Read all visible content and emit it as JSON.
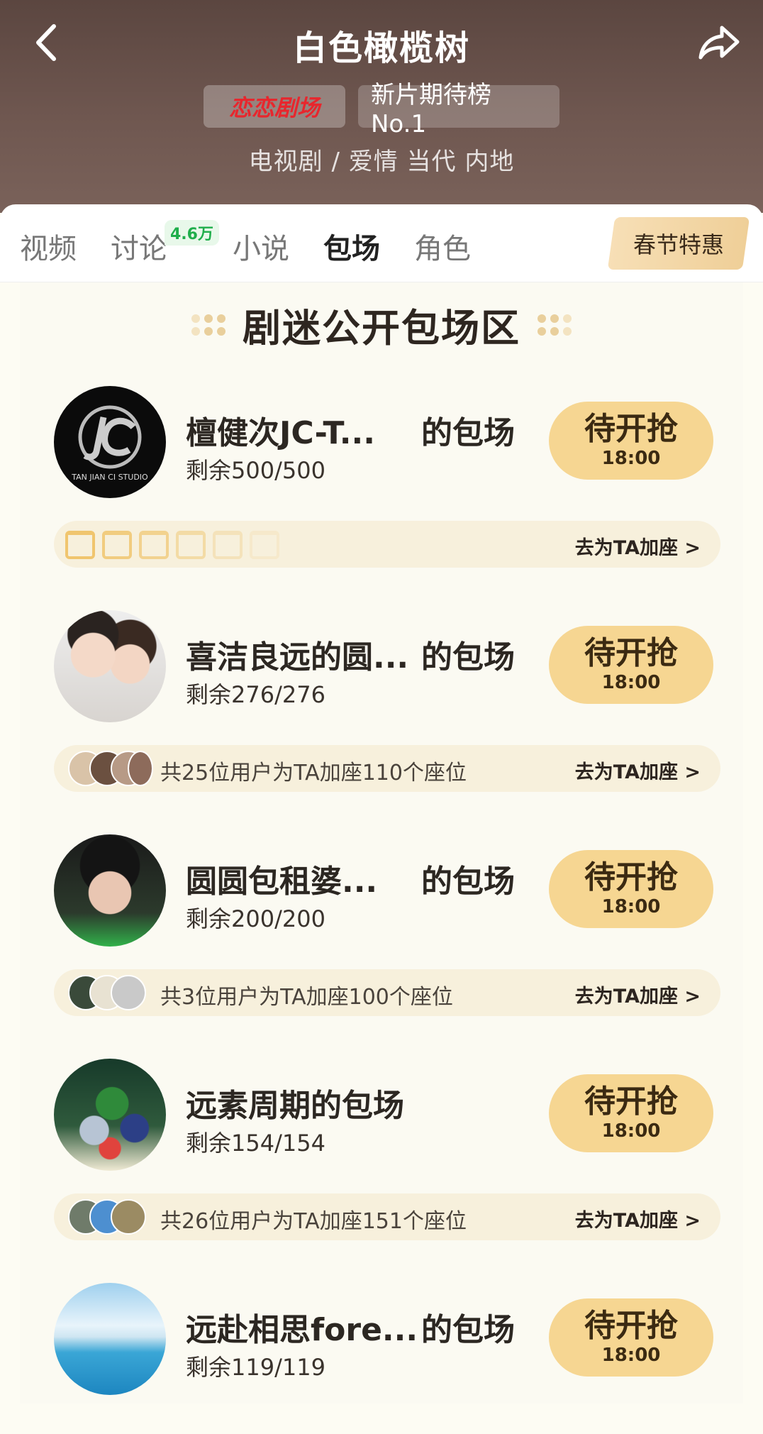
{
  "header": {
    "title": "白色橄榄树",
    "brand_badge": "恋恋剧场",
    "rank_badge": "新片期待榜No.1",
    "genre": "电视剧 / 爱情 当代 内地"
  },
  "tabs": [
    {
      "label": "视频",
      "active": false
    },
    {
      "label": "讨论",
      "active": false,
      "badge": "4.6万"
    },
    {
      "label": "小说",
      "active": false
    },
    {
      "label": "包场",
      "active": true
    },
    {
      "label": "角色",
      "active": false
    }
  ],
  "promo": "春节特惠",
  "section_title": "剧迷公开包场区",
  "entries": [
    {
      "name": "檀健次JC-T...",
      "suffix": "的包场",
      "remain": "剩余500/500",
      "button": "待开抢",
      "time": "18:00",
      "avatar_text": "TAN JIAN CI STUDIO",
      "seat_info": "",
      "go": "去为TA加座 >"
    },
    {
      "name": "喜洁良远的圆...",
      "suffix": "的包场",
      "remain": "剩余276/276",
      "button": "待开抢",
      "time": "18:00",
      "seat_info": "共25位用户为TA加座110个座位",
      "go": "去为TA加座 >"
    },
    {
      "name": "圆圆包租婆...",
      "suffix": "的包场",
      "remain": "剩余200/200",
      "button": "待开抢",
      "time": "18:00",
      "seat_info": "共3位用户为TA加座100个座位",
      "go": "去为TA加座 >"
    },
    {
      "name": "远素周期的包场",
      "suffix": "",
      "remain": "剩余154/154",
      "button": "待开抢",
      "time": "18:00",
      "seat_info": "共26位用户为TA加座151个座位",
      "go": "去为TA加座 >"
    },
    {
      "name": "远赴相思fore...",
      "suffix": "的包场",
      "remain": "剩余119/119",
      "button": "待开抢",
      "time": "18:00"
    }
  ],
  "colors": {
    "header_bg": "#6f5750",
    "button_bg": "#f6d692",
    "brand_red": "#e8262d",
    "badge_green": "#1fae4b"
  },
  "icons": {
    "back": "chevron-left-icon",
    "share": "share-icon",
    "seat": "seat-icon"
  }
}
